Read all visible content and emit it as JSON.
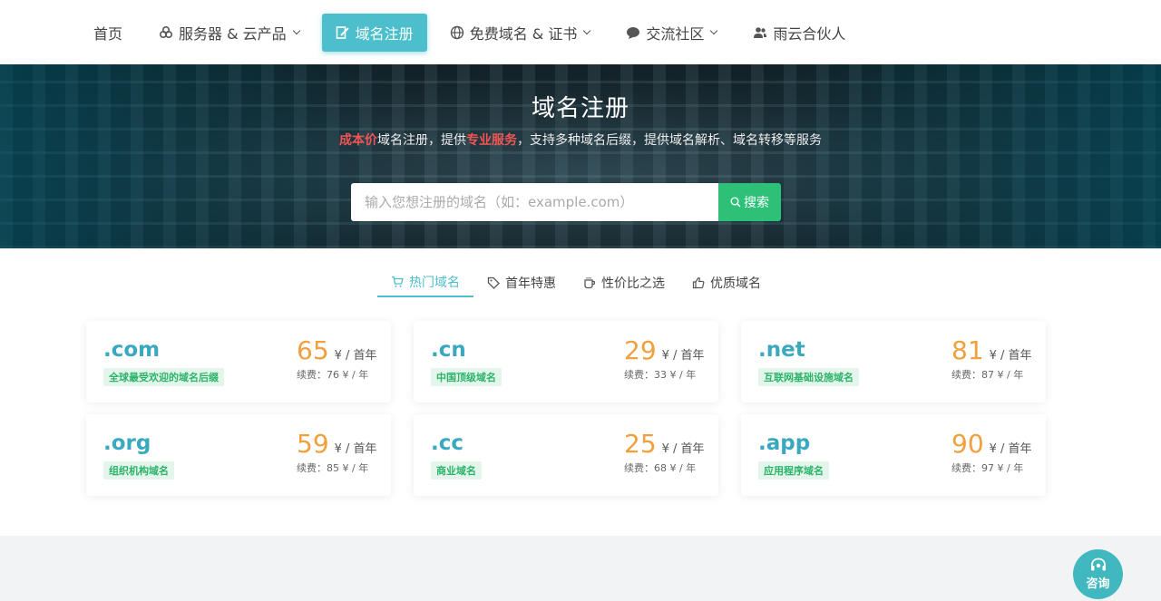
{
  "nav": {
    "items": [
      {
        "label": "首页"
      },
      {
        "label": "服务器 & 云产品"
      },
      {
        "label": "域名注册"
      },
      {
        "label": "免费域名 & 证书"
      },
      {
        "label": "交流社区"
      },
      {
        "label": "雨云合伙人"
      }
    ]
  },
  "hero": {
    "title": "域名注册",
    "subtitle": {
      "part1": "成本价",
      "part2": "域名注册，提供",
      "part3": "专业服务",
      "part4": "，支持多种域名后缀，提供域名解析、域名转移等服务"
    },
    "search": {
      "placeholder": "输入您想注册的域名（如：example.com）",
      "button_label": "搜索"
    }
  },
  "tabs": [
    {
      "label": "热门域名"
    },
    {
      "label": "首年特惠"
    },
    {
      "label": "性价比之选"
    },
    {
      "label": "优质域名"
    }
  ],
  "domains": [
    {
      "suffix": ".com",
      "tag": "全球最受欢迎的域名后缀",
      "price": "65",
      "unit": "¥ / 首年",
      "renew": "续费：76 ¥ / 年"
    },
    {
      "suffix": ".cn",
      "tag": "中国顶级域名",
      "price": "29",
      "unit": "¥ / 首年",
      "renew": "续费：33 ¥ / 年"
    },
    {
      "suffix": ".net",
      "tag": "互联网基础设施域名",
      "price": "81",
      "unit": "¥ / 首年",
      "renew": "续费：87 ¥ / 年"
    },
    {
      "suffix": ".org",
      "tag": "组织机构域名",
      "price": "59",
      "unit": "¥ / 首年",
      "renew": "续费：85 ¥ / 年"
    },
    {
      "suffix": ".cc",
      "tag": "商业域名",
      "price": "25",
      "unit": "¥ / 首年",
      "renew": "续费：68 ¥ / 年"
    },
    {
      "suffix": ".app",
      "tag": "应用程序域名",
      "price": "90",
      "unit": "¥ / 首年",
      "renew": "续费：97 ¥ / 年"
    }
  ],
  "consult": {
    "label": "咨询"
  },
  "colors": {
    "accent": "#4dbfcc",
    "search_button": "#2cc177",
    "price": "#f0a03c",
    "highlight": "#f25555"
  }
}
